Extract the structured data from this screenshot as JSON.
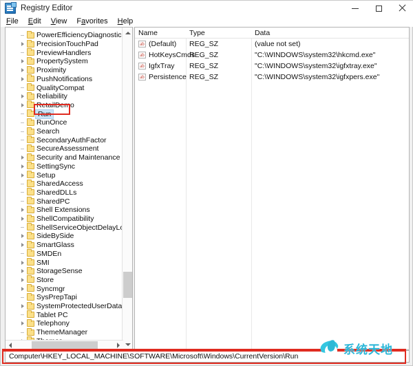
{
  "window": {
    "title": "Registry Editor",
    "icon": "registry-editor-icon",
    "controls": {
      "minimize": "–",
      "maximize": "□",
      "close": "×"
    }
  },
  "menubar": {
    "items": [
      {
        "label": "File",
        "accelerator": "F"
      },
      {
        "label": "Edit",
        "accelerator": "E"
      },
      {
        "label": "View",
        "accelerator": "V"
      },
      {
        "label": "Favorites",
        "accelerator": "a"
      },
      {
        "label": "Help",
        "accelerator": "H"
      }
    ]
  },
  "tree": {
    "items": [
      {
        "label": "PowerEfficiencyDiagnostics",
        "expandable": false,
        "selected": false
      },
      {
        "label": "PrecisionTouchPad",
        "expandable": true,
        "selected": false
      },
      {
        "label": "PreviewHandlers",
        "expandable": false,
        "selected": false
      },
      {
        "label": "PropertySystem",
        "expandable": true,
        "selected": false
      },
      {
        "label": "Proximity",
        "expandable": true,
        "selected": false
      },
      {
        "label": "PushNotifications",
        "expandable": true,
        "selected": false
      },
      {
        "label": "QualityCompat",
        "expandable": false,
        "selected": false
      },
      {
        "label": "Reliability",
        "expandable": true,
        "selected": false
      },
      {
        "label": "RetailDemo",
        "expandable": true,
        "selected": false
      },
      {
        "label": "Run",
        "expandable": false,
        "selected": true
      },
      {
        "label": "RunOnce",
        "expandable": false,
        "selected": false
      },
      {
        "label": "Search",
        "expandable": false,
        "selected": false
      },
      {
        "label": "SecondaryAuthFactor",
        "expandable": false,
        "selected": false
      },
      {
        "label": "SecureAssessment",
        "expandable": false,
        "selected": false
      },
      {
        "label": "Security and Maintenance",
        "expandable": true,
        "selected": false
      },
      {
        "label": "SettingSync",
        "expandable": true,
        "selected": false
      },
      {
        "label": "Setup",
        "expandable": true,
        "selected": false
      },
      {
        "label": "SharedAccess",
        "expandable": false,
        "selected": false
      },
      {
        "label": "SharedDLLs",
        "expandable": false,
        "selected": false
      },
      {
        "label": "SharedPC",
        "expandable": false,
        "selected": false
      },
      {
        "label": "Shell Extensions",
        "expandable": true,
        "selected": false
      },
      {
        "label": "ShellCompatibility",
        "expandable": true,
        "selected": false
      },
      {
        "label": "ShellServiceObjectDelayLoad",
        "expandable": false,
        "selected": false
      },
      {
        "label": "SideBySide",
        "expandable": true,
        "selected": false
      },
      {
        "label": "SmartGlass",
        "expandable": true,
        "selected": false
      },
      {
        "label": "SMDEn",
        "expandable": false,
        "selected": false
      },
      {
        "label": "SMI",
        "expandable": true,
        "selected": false
      },
      {
        "label": "StorageSense",
        "expandable": true,
        "selected": false
      },
      {
        "label": "Store",
        "expandable": true,
        "selected": false
      },
      {
        "label": "Syncmgr",
        "expandable": true,
        "selected": false
      },
      {
        "label": "SysPrepTapi",
        "expandable": false,
        "selected": false
      },
      {
        "label": "SystemProtectedUserData",
        "expandable": true,
        "selected": false
      },
      {
        "label": "Tablet PC",
        "expandable": false,
        "selected": false
      },
      {
        "label": "Telephony",
        "expandable": true,
        "selected": false
      },
      {
        "label": "ThemeManager",
        "expandable": false,
        "selected": false
      },
      {
        "label": "Themes",
        "expandable": true,
        "selected": false
      }
    ]
  },
  "values": {
    "columns": [
      "Name",
      "Type",
      "Data"
    ],
    "rows": [
      {
        "name": "(Default)",
        "type": "REG_SZ",
        "data": "(value not set)"
      },
      {
        "name": "HotKeysCmds",
        "type": "REG_SZ",
        "data": "\"C:\\WINDOWS\\system32\\hkcmd.exe\""
      },
      {
        "name": "IgfxTray",
        "type": "REG_SZ",
        "data": "\"C:\\WINDOWS\\system32\\igfxtray.exe\""
      },
      {
        "name": "Persistence",
        "type": "REG_SZ",
        "data": "\"C:\\WINDOWS\\system32\\igfxpers.exe\""
      }
    ],
    "value_icon": "string-value-icon",
    "value_icon_glyph": "ab"
  },
  "statusbar": {
    "path": "Computer\\HKEY_LOCAL_MACHINE\\SOFTWARE\\Microsoft\\Windows\\CurrentVersion\\Run"
  },
  "watermark": {
    "text": "系统天地",
    "logo": "swoosh-logo"
  },
  "annotations": {
    "accent_color": "#e02b20",
    "selection_color": "#cce4f7"
  }
}
